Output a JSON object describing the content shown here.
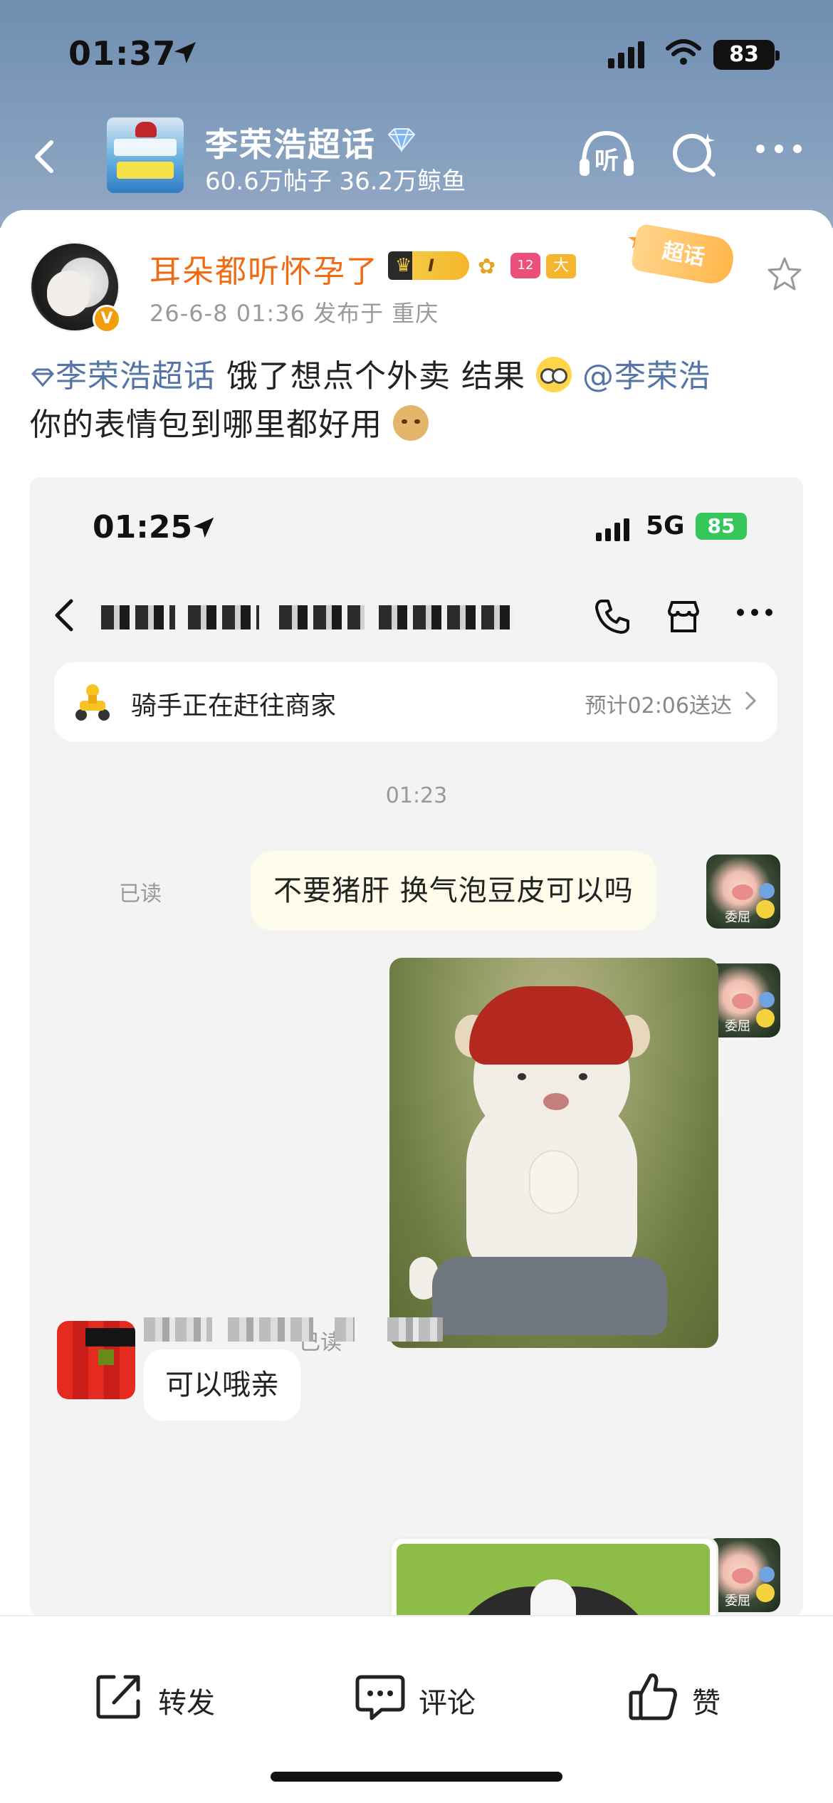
{
  "status_bar": {
    "time": "01:37",
    "battery": "83"
  },
  "header": {
    "topic_title": "李荣浩超话",
    "topic_stats": "60.6万帖子 36.2万鲸鱼",
    "listen_label": "听"
  },
  "post": {
    "username": "耳朵都听怀孕了",
    "crown_level": "I",
    "member_level": "12",
    "daka_badge": "大咖",
    "chaohua_tag": "超话",
    "meta": "26-6-8 01:36  发布于 重庆",
    "text": {
      "topic_link": "李荣浩超话",
      "segment1": " 饿了想点个外卖 结果",
      "mention": "@李荣浩",
      "segment2": "你的表情包到哪里都好用"
    }
  },
  "screenshot": {
    "status_time": "01:25",
    "network": "5G",
    "battery": "85",
    "rider_status": "骑手正在赶往商家",
    "eta": "预计02:06送达",
    "timestamp": "01:23",
    "read_label": "已读",
    "my_message": "不要猪肝 换气泡豆皮可以吗",
    "avatar_caption": "委屈",
    "reply_message": "可以哦亲"
  },
  "actions": {
    "share": "转发",
    "comment": "评论",
    "like": "赞"
  },
  "colors": {
    "header_blue": "#7e9abb",
    "username_orange": "#f06b14",
    "link_blue": "#5475a6",
    "my_bubble": "#fdfbea"
  }
}
